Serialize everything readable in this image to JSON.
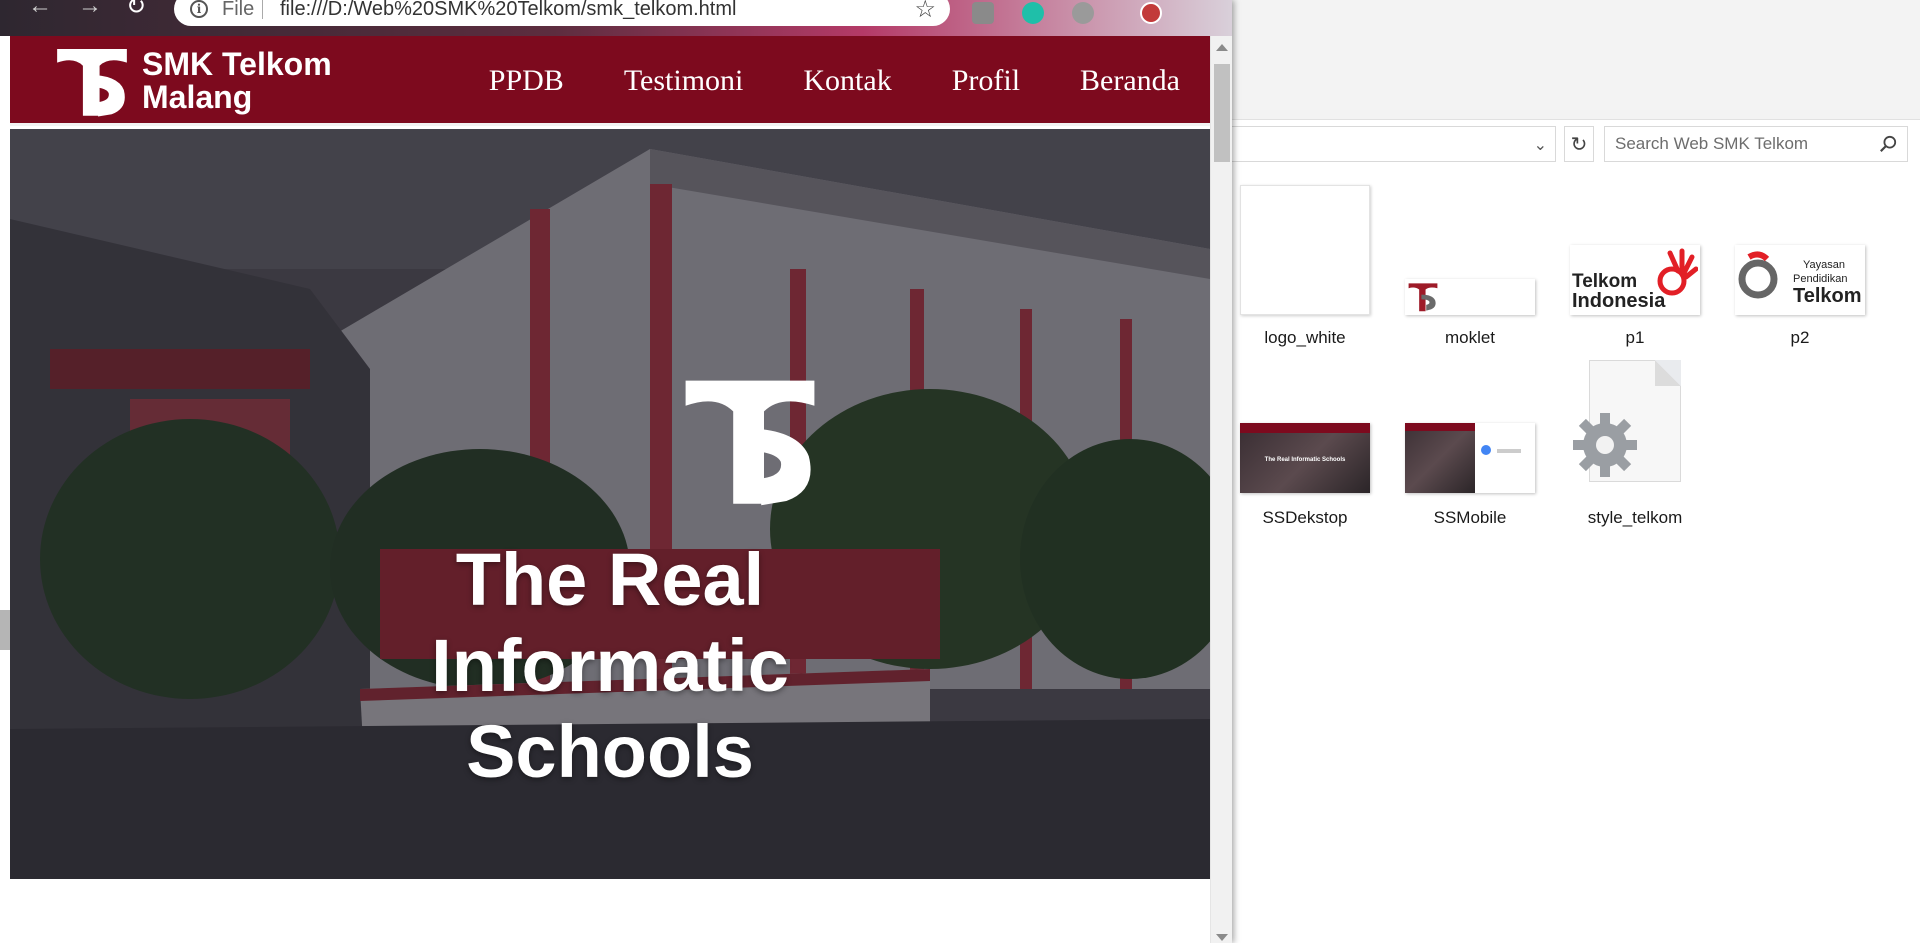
{
  "browser": {
    "scheme_label": "File",
    "url": "file:///D:/Web%20SMK%20Telkom/smk_telkom.html"
  },
  "site": {
    "name_line1": "SMK Telkom",
    "name_line2": "Malang",
    "nav": [
      "PPDB",
      "Testimoni",
      "Kontak",
      "Profil",
      "Beranda"
    ],
    "hero_title_line1": "The Real Informatic",
    "hero_title_line2": "Schools",
    "colors": {
      "brand": "#7d0a1e",
      "text_on_brand": "#ffffff"
    }
  },
  "explorer": {
    "search_placeholder": "Search Web SMK Telkom",
    "files": [
      {
        "name": "logo_white",
        "icon": "image-thumbnail"
      },
      {
        "name": "moklet",
        "icon": "image-thumbnail"
      },
      {
        "name": "p1",
        "icon": "image-thumbnail",
        "thumb_text": [
          "Telkom",
          "Indonesia"
        ]
      },
      {
        "name": "p2",
        "icon": "image-thumbnail",
        "thumb_text": [
          "Yayasan",
          "Pendidikan",
          "Telkom"
        ]
      },
      {
        "name": "SSDekstop",
        "icon": "image-thumbnail",
        "thumb_text": [
          "The Real Informatic Schools"
        ]
      },
      {
        "name": "SSMobile",
        "icon": "image-thumbnail"
      },
      {
        "name": "style_telkom",
        "icon": "settings-file-icon"
      }
    ]
  }
}
